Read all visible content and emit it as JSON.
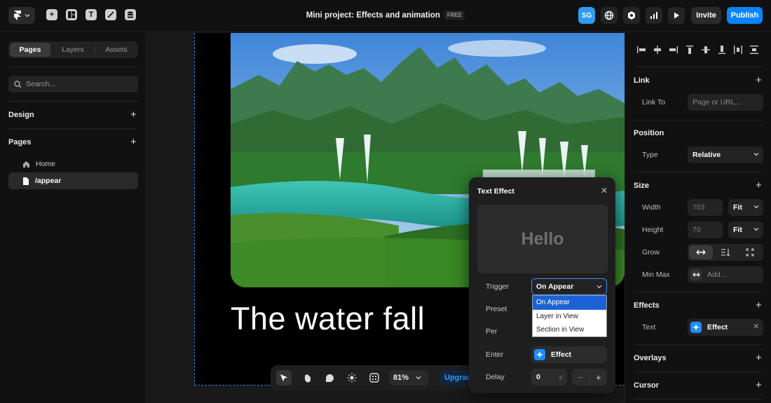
{
  "header": {
    "title": "Mini project: Effects and animation",
    "plan_badge": "FREE",
    "avatar_initials": "SG",
    "invite_label": "Invite",
    "publish_label": "Publish",
    "accent_color": "#0a84ff",
    "avatar_color": "#2f9bf1"
  },
  "left": {
    "tabs": [
      "Pages",
      "Layers",
      "Assets"
    ],
    "active_tab": "Pages",
    "search_placeholder": "Search...",
    "design_title": "Design",
    "pages_title": "Pages",
    "pages": [
      {
        "label": "Home",
        "icon": "home-icon"
      },
      {
        "label": "/appear",
        "icon": "page-icon",
        "active": true
      }
    ]
  },
  "canvas": {
    "heading": "The water fall",
    "zoom": "81%",
    "upgrade_label": "Upgrade",
    "frame_outline_color": "#2f7ed8"
  },
  "popover": {
    "title": "Text Effect",
    "preview_text": "Hello",
    "trigger_label": "Trigger",
    "trigger_value": "On Appear",
    "trigger_options": [
      "On Appear",
      "Layer in View",
      "Section in View"
    ],
    "preset_label": "Preset",
    "per_label": "Per",
    "enter_label": "Enter",
    "enter_value": "Effect",
    "delay_label": "Delay",
    "delay_value": "0",
    "delay_unit": "s",
    "stepper_minus": "−",
    "stepper_plus": "+"
  },
  "right": {
    "link": {
      "title": "Link",
      "link_to_label": "Link To",
      "link_to_placeholder": "Page or URL..."
    },
    "position": {
      "title": "Position",
      "type_label": "Type",
      "type_value": "Relative"
    },
    "size": {
      "title": "Size",
      "width_label": "Width",
      "width_value": "703",
      "width_mode": "Fit",
      "height_label": "Height",
      "height_value": "70",
      "height_mode": "Fit",
      "grow_label": "Grow",
      "minmax_label": "Min Max",
      "minmax_placeholder": "Add..."
    },
    "effects": {
      "title": "Effects",
      "text_label": "Text",
      "text_value": "Effect"
    },
    "overlays": {
      "title": "Overlays"
    },
    "cursor": {
      "title": "Cursor"
    }
  }
}
